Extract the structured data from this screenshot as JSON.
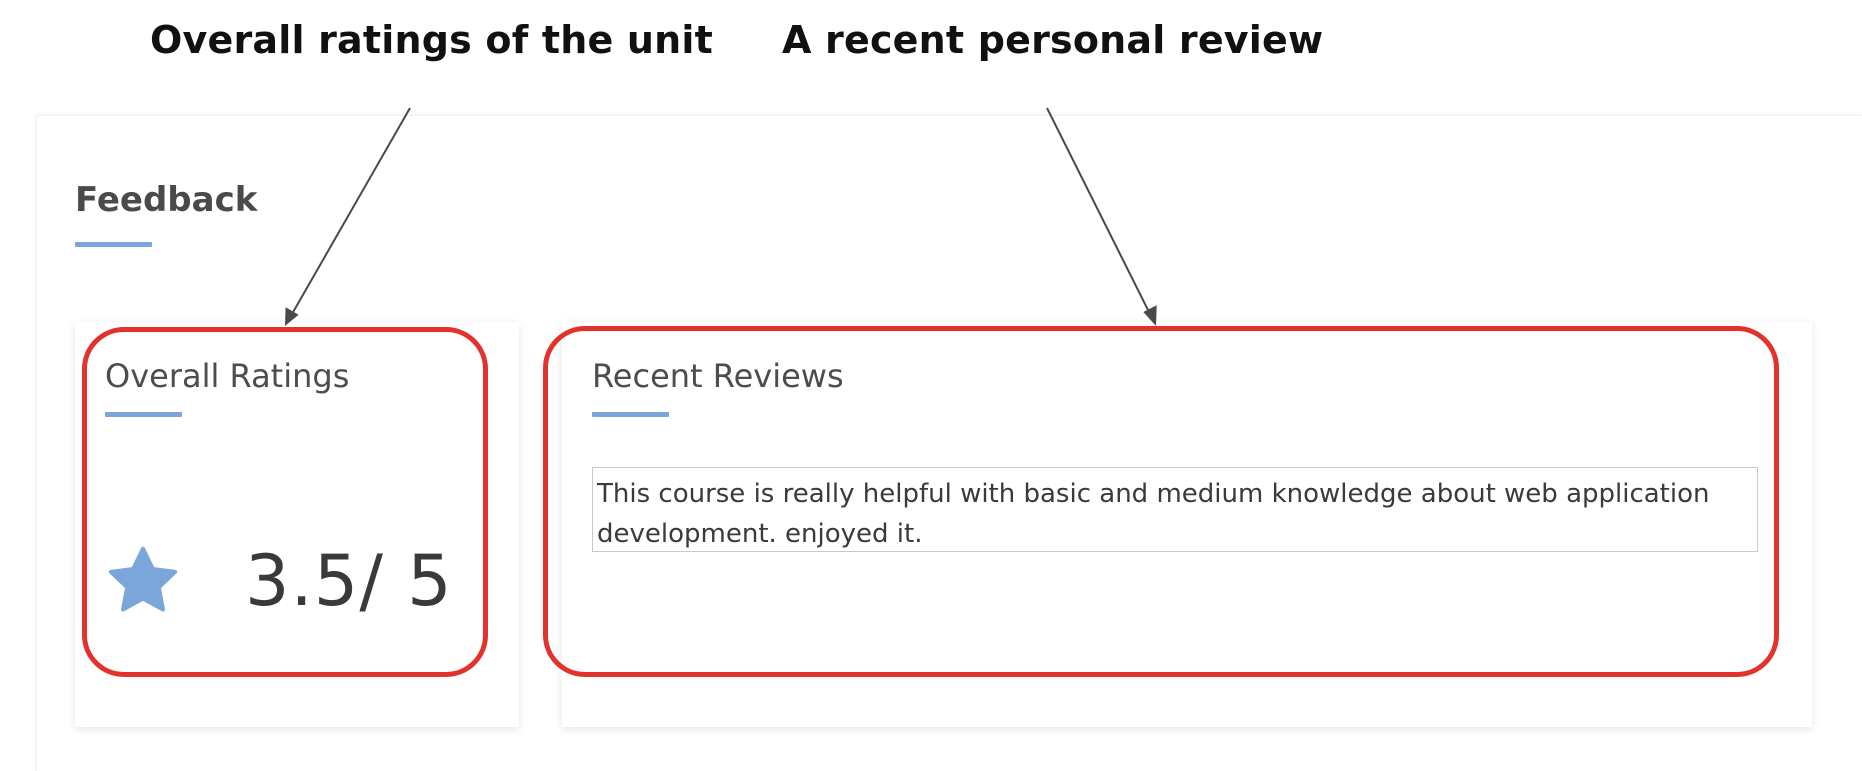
{
  "annotations": {
    "left_caption": "Overall ratings of the unit",
    "right_caption": "A recent personal review",
    "highlight_color": "#e2322b"
  },
  "feedback": {
    "title": "Feedback",
    "accent_color": "#7aa6d9"
  },
  "overall_ratings": {
    "title": "Overall Ratings",
    "icon": "star-icon",
    "score": 3.5,
    "max": 5,
    "score_text": "3.5/ 5"
  },
  "recent_reviews": {
    "title": "Recent Reviews",
    "items": [
      {
        "text": "This course is really helpful with basic and medium knowledge about web application development. enjoyed it."
      }
    ]
  }
}
